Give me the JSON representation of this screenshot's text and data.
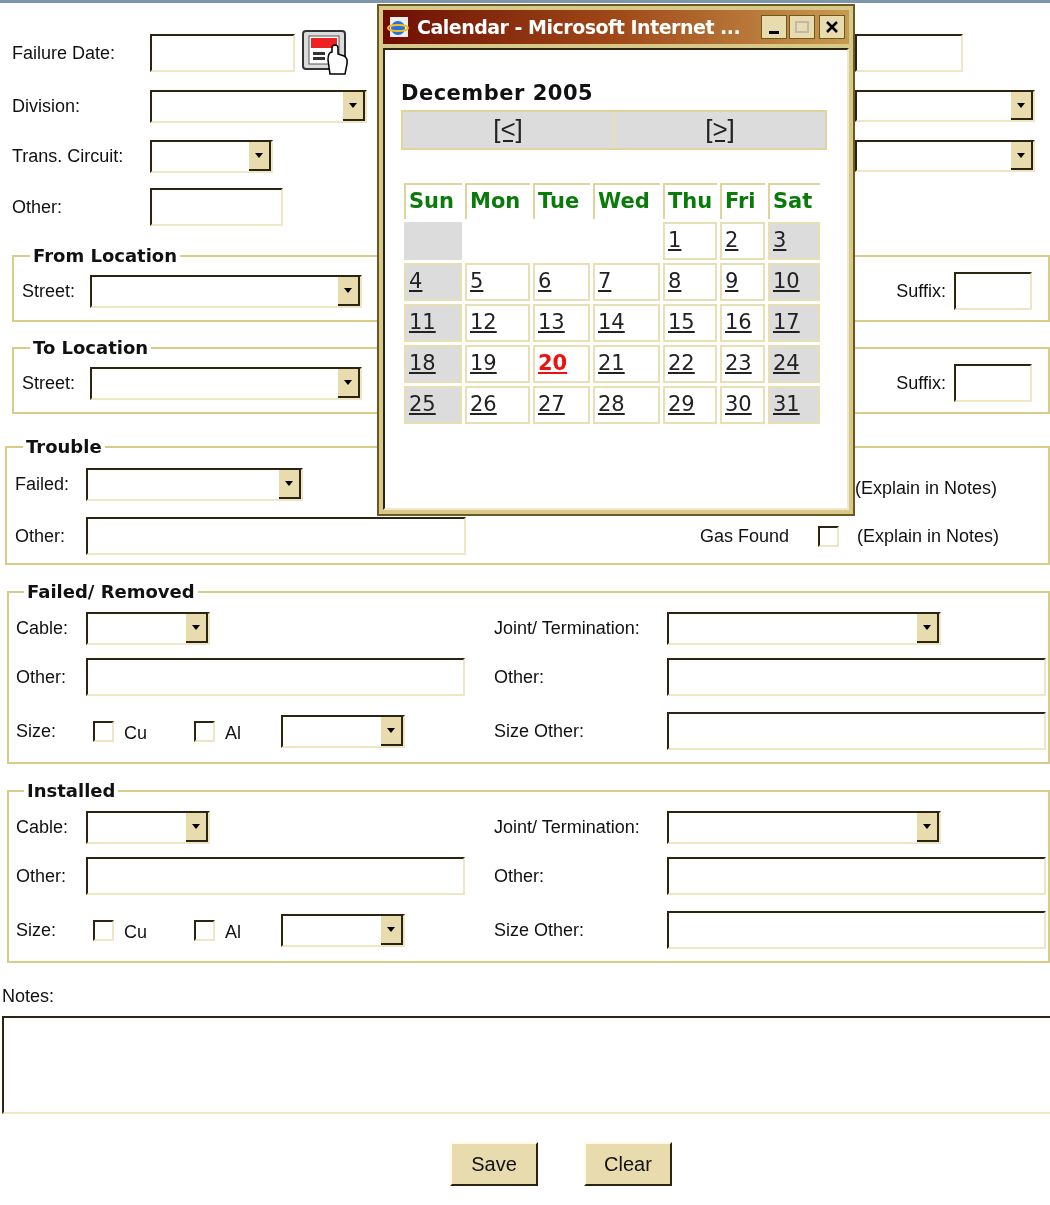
{
  "header_fields": [
    {
      "label": "Failure Date:",
      "kind": "date"
    },
    {
      "label": "Division:",
      "kind": "select"
    },
    {
      "label": "Trans. Circuit:",
      "kind": "select"
    },
    {
      "label": "Other:",
      "kind": "text"
    }
  ],
  "locations": [
    {
      "legend": "From Location",
      "street_label": "Street:",
      "suffix_label": "Suffix:"
    },
    {
      "legend": "To Location",
      "street_label": "Street:",
      "suffix_label": "Suffix:"
    }
  ],
  "trouble": {
    "legend": "Trouble",
    "failed_label": "Failed:",
    "failed_hint": "(Explain in Notes)",
    "other_label": "Other:",
    "gas_found": {
      "label": "Gas Found",
      "checked": false,
      "hint": "(Explain in Notes)"
    }
  },
  "cable_sections": [
    {
      "legend": "Failed/ Removed",
      "cable_label": "Cable:",
      "joint_label": "Joint/ Termination:",
      "other_label": "Other:",
      "other_right_label": "Other:",
      "size_label": "Size:",
      "size_options": [
        {
          "label": "Cu",
          "checked": false
        },
        {
          "label": "Al",
          "checked": false
        }
      ],
      "size_other_label": "Size Other:"
    },
    {
      "legend": "Installed",
      "cable_label": "Cable:",
      "joint_label": "Joint/ Termination:",
      "other_label": "Other:",
      "other_right_label": "Other:",
      "size_label": "Size:",
      "size_options": [
        {
          "label": "Cu",
          "checked": false
        },
        {
          "label": "Al",
          "checked": false
        }
      ],
      "size_other_label": "Size Other:"
    }
  ],
  "notes": {
    "label": "Notes:"
  },
  "buttons": [
    "Save",
    "Clear"
  ],
  "popup": {
    "title": "Calendar - Microsoft Internet ...",
    "month": "December 2005",
    "nav": [
      "[<]",
      "[>]"
    ],
    "weekdays": [
      "Sun",
      "Mon",
      "Tue",
      "Wed",
      "Thu",
      "Fri",
      "Sat"
    ],
    "weeks": [
      [
        {
          "kind": "blank",
          "weekend": true
        },
        {
          "kind": "blank"
        },
        {
          "kind": "blank"
        },
        {
          "kind": "blank"
        },
        {
          "kind": "day",
          "day": "1",
          "weekend": false,
          "today": false
        },
        {
          "kind": "day",
          "day": "2",
          "weekend": false,
          "today": false
        },
        {
          "kind": "day",
          "day": "3",
          "weekend": true,
          "today": false
        }
      ],
      [
        {
          "kind": "day",
          "day": "4",
          "weekend": true,
          "today": false
        },
        {
          "kind": "day",
          "day": "5",
          "weekend": false,
          "today": false
        },
        {
          "kind": "day",
          "day": "6",
          "weekend": false,
          "today": false
        },
        {
          "kind": "day",
          "day": "7",
          "weekend": false,
          "today": false
        },
        {
          "kind": "day",
          "day": "8",
          "weekend": false,
          "today": false
        },
        {
          "kind": "day",
          "day": "9",
          "weekend": false,
          "today": false
        },
        {
          "kind": "day",
          "day": "10",
          "weekend": true,
          "today": false
        }
      ],
      [
        {
          "kind": "day",
          "day": "11",
          "weekend": true,
          "today": false
        },
        {
          "kind": "day",
          "day": "12",
          "weekend": false,
          "today": false
        },
        {
          "kind": "day",
          "day": "13",
          "weekend": false,
          "today": false
        },
        {
          "kind": "day",
          "day": "14",
          "weekend": false,
          "today": false
        },
        {
          "kind": "day",
          "day": "15",
          "weekend": false,
          "today": false
        },
        {
          "kind": "day",
          "day": "16",
          "weekend": false,
          "today": false
        },
        {
          "kind": "day",
          "day": "17",
          "weekend": true,
          "today": false
        }
      ],
      [
        {
          "kind": "day",
          "day": "18",
          "weekend": true,
          "today": false
        },
        {
          "kind": "day",
          "day": "19",
          "weekend": false,
          "today": false
        },
        {
          "kind": "day",
          "day": "20",
          "weekend": false,
          "today": true
        },
        {
          "kind": "day",
          "day": "21",
          "weekend": false,
          "today": false
        },
        {
          "kind": "day",
          "day": "22",
          "weekend": false,
          "today": false
        },
        {
          "kind": "day",
          "day": "23",
          "weekend": false,
          "today": false
        },
        {
          "kind": "day",
          "day": "24",
          "weekend": true,
          "today": false
        }
      ],
      [
        {
          "kind": "day",
          "day": "25",
          "weekend": true,
          "today": false
        },
        {
          "kind": "day",
          "day": "26",
          "weekend": false,
          "today": false
        },
        {
          "kind": "day",
          "day": "27",
          "weekend": false,
          "today": false
        },
        {
          "kind": "day",
          "day": "28",
          "weekend": false,
          "today": false
        },
        {
          "kind": "day",
          "day": "29",
          "weekend": false,
          "today": false
        },
        {
          "kind": "day",
          "day": "30",
          "weekend": false,
          "today": false
        },
        {
          "kind": "day",
          "day": "31",
          "weekend": true,
          "today": false
        }
      ]
    ]
  }
}
